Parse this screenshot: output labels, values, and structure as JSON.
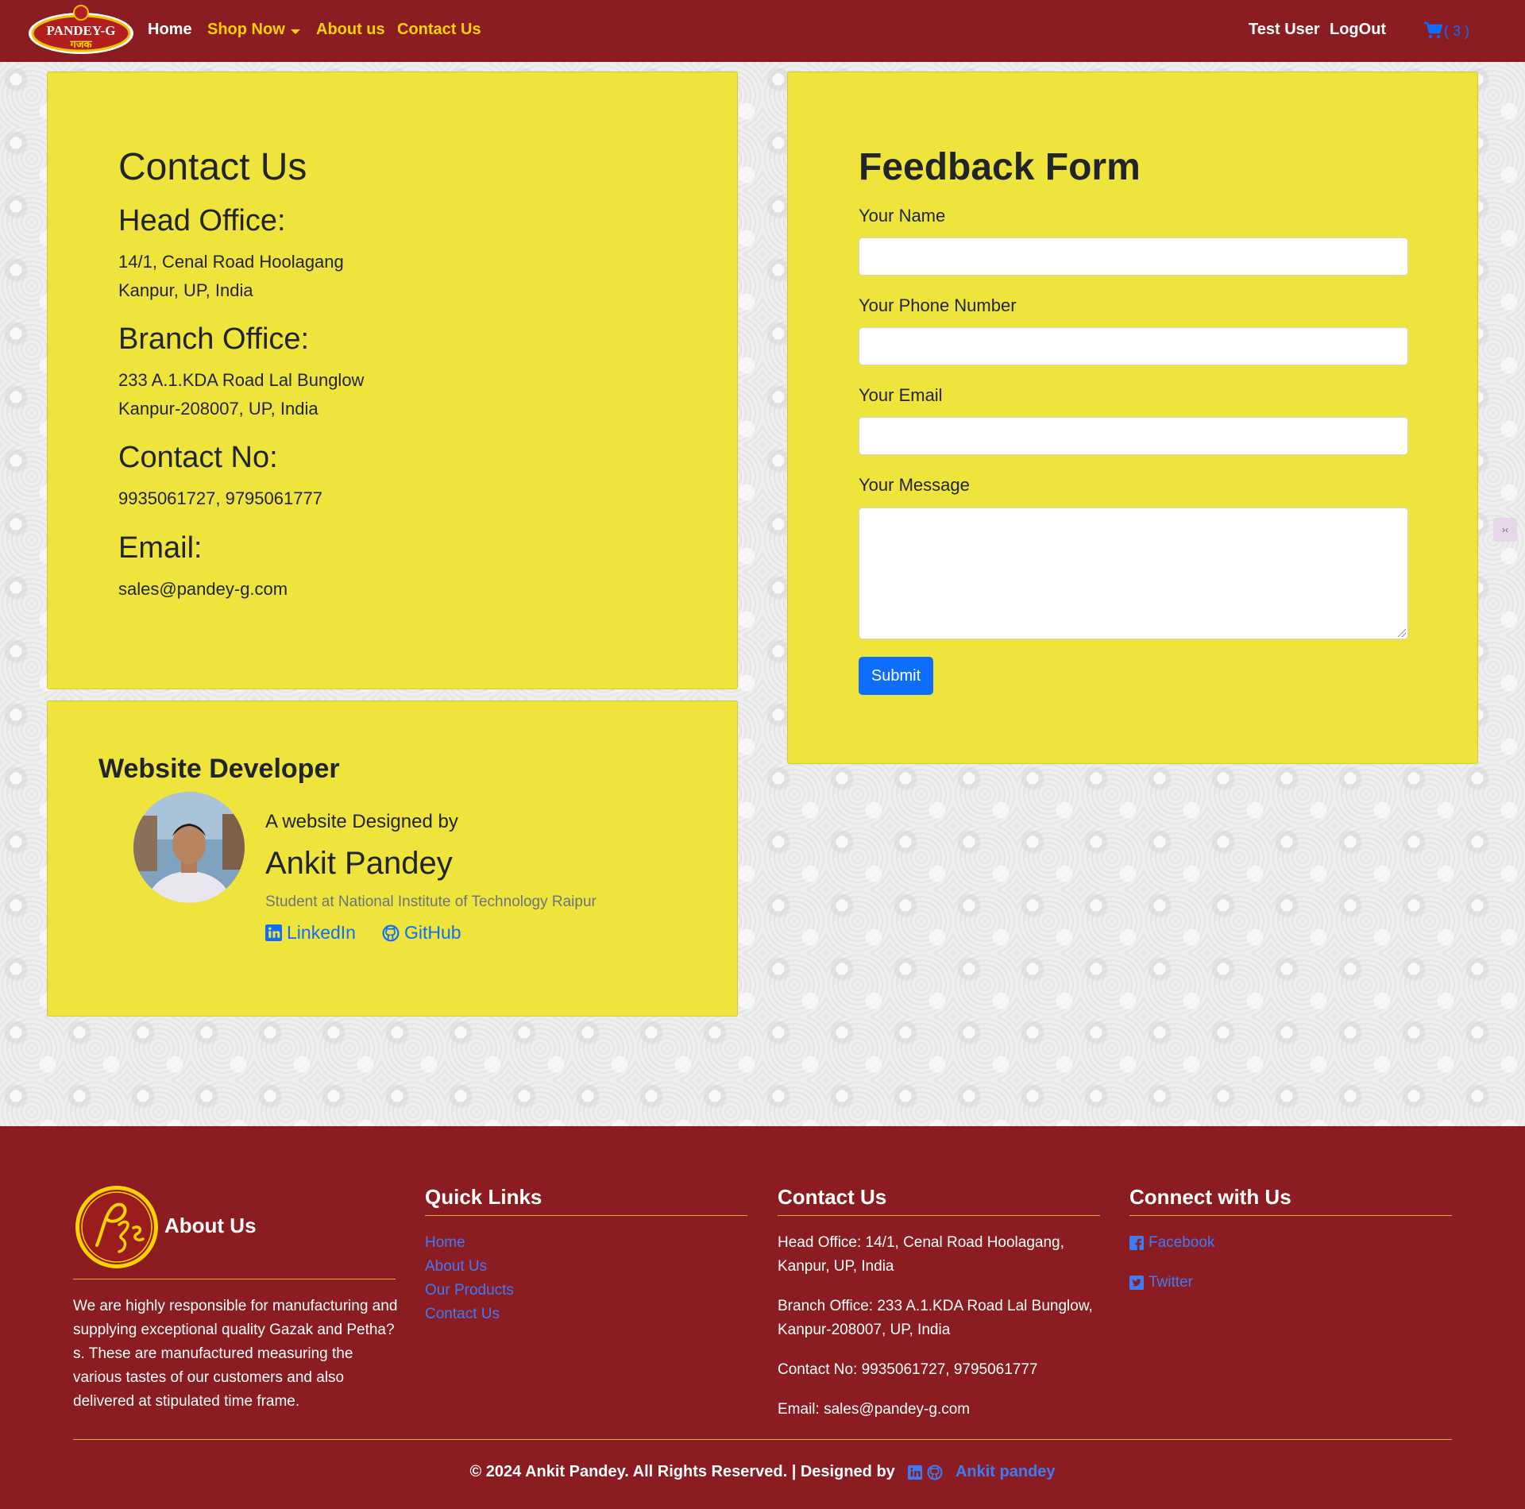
{
  "nav": {
    "logo_text": "PANDEY-G",
    "logo_subtext": "गजक",
    "home": "Home",
    "shop_now": "Shop Now",
    "about": "About us",
    "contact": "Contact Us",
    "user": "Test User",
    "logout": "LogOut",
    "cart_count": "( 3 )"
  },
  "contact_card": {
    "title": "Contact Us",
    "head_office_label": "Head Office:",
    "head_office_line1": "14/1, Cenal Road Hoolagang",
    "head_office_line2": "Kanpur, UP, India",
    "branch_office_label": "Branch Office:",
    "branch_office_line1": "233 A.1.KDA Road Lal Bunglow",
    "branch_office_line2": "Kanpur-208007, UP, India",
    "contact_no_label": "Contact No:",
    "contact_no": "9935061727, 9795061777",
    "email_label": "Email:",
    "email": "sales@pandey-g.com"
  },
  "developer_card": {
    "title": "Website Developer",
    "designed_by": "A website Designed by",
    "name": "Ankit Pandey",
    "school": "Student at National Institute of Technology Raipur",
    "linkedin": "LinkedIn",
    "github": "GitHub"
  },
  "feedback_form": {
    "title": "Feedback Form",
    "name_label": "Your Name",
    "name_value": "",
    "phone_label": "Your Phone Number",
    "phone_value": "",
    "email_label": "Your Email",
    "email_value": "",
    "message_label": "Your Message",
    "message_value": "",
    "submit": "Submit"
  },
  "footer": {
    "about_title": "About Us",
    "about_text": "We are highly responsible for manufacturing and supplying exceptional quality Gazak and Petha?s. These are manufactured measuring the various tastes of our customers and also delivered at stipulated time frame.",
    "quick_links_title": "Quick Links",
    "quick_links": [
      "Home",
      "About Us",
      "Our Products",
      "Contact Us"
    ],
    "contact_title": "Contact Us",
    "contact_head_office": "Head Office: 14/1, Cenal Road Hoolagang, Kanpur, UP, India",
    "contact_branch_office": "Branch Office: 233 A.1.KDA Road Lal Bunglow, Kanpur-208007, UP, India",
    "contact_no": "Contact No: 9935061727, 9795061777",
    "contact_email": "Email: sales@pandey-g.com",
    "connect_title": "Connect with Us",
    "facebook": "Facebook",
    "twitter": "Twitter",
    "copyright": "© 2024 Ankit Pandey. All Rights Reserved. | Designed by",
    "designer_link": "Ankit pandey"
  },
  "colors": {
    "brand_maroon": "#8a1c22",
    "card_yellow": "#efe43b",
    "nav_accent": "#ffd200",
    "link_blue": "#0d6efd"
  },
  "icons": {
    "cart": "cart-icon",
    "linkedin": "linkedin-icon",
    "github": "github-icon",
    "facebook": "facebook-icon",
    "twitter": "twitter-icon"
  }
}
